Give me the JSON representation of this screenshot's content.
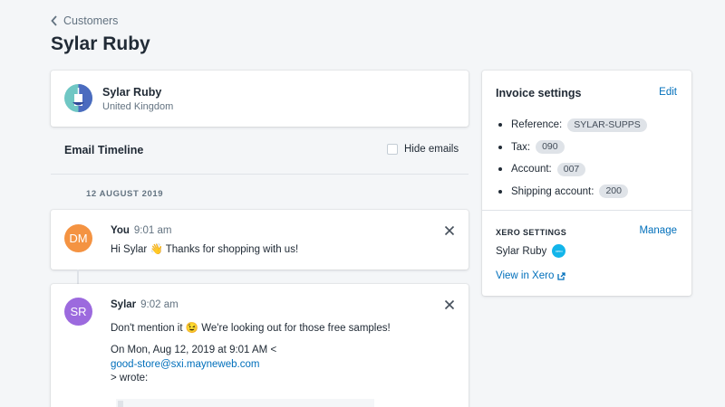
{
  "breadcrumb": {
    "label": "Customers"
  },
  "page": {
    "title": "Sylar Ruby"
  },
  "customer": {
    "name": "Sylar Ruby",
    "country": "United Kingdom"
  },
  "timeline": {
    "title": "Email Timeline",
    "hide_emails_label": "Hide emails",
    "hide_emails_checked": false,
    "date": "12 AUGUST 2019",
    "messages": [
      {
        "initials": "DM",
        "avatar_color": "#f49342",
        "sender": "You",
        "time": "9:01 am",
        "body": "Hi Sylar 👋  Thanks for shopping with us!"
      },
      {
        "initials": "SR",
        "avatar_color": "#9c6ade",
        "sender": "Sylar",
        "time": "9:02 am",
        "body": "Don't mention it 😉  We're looking out for those free samples!",
        "quote_line1": "On Mon, Aug 12, 2019 at 9:01 AM <",
        "quote_email": "good-store@sxi.mayneweb.com",
        "quote_line3": "> wrote:"
      }
    ]
  },
  "invoice_settings": {
    "title": "Invoice settings",
    "edit_label": "Edit",
    "items": [
      {
        "label": "Reference:",
        "value": "SYLAR-SUPPS"
      },
      {
        "label": "Tax:",
        "value": "090"
      },
      {
        "label": "Account:",
        "value": "007"
      },
      {
        "label": "Shipping account:",
        "value": "200"
      }
    ]
  },
  "xero": {
    "heading": "XERO SETTINGS",
    "manage_label": "Manage",
    "contact_name": "Sylar Ruby",
    "badge_text": "xero",
    "view_label": "View in Xero"
  },
  "colors": {
    "link": "#006fbb",
    "pill": "#dfe3e8",
    "xero": "#13b5ea"
  },
  "icons": [
    "chevron-left-icon",
    "close-icon",
    "external-link-icon",
    "xero-logo-icon",
    "customer-logo-icon"
  ]
}
